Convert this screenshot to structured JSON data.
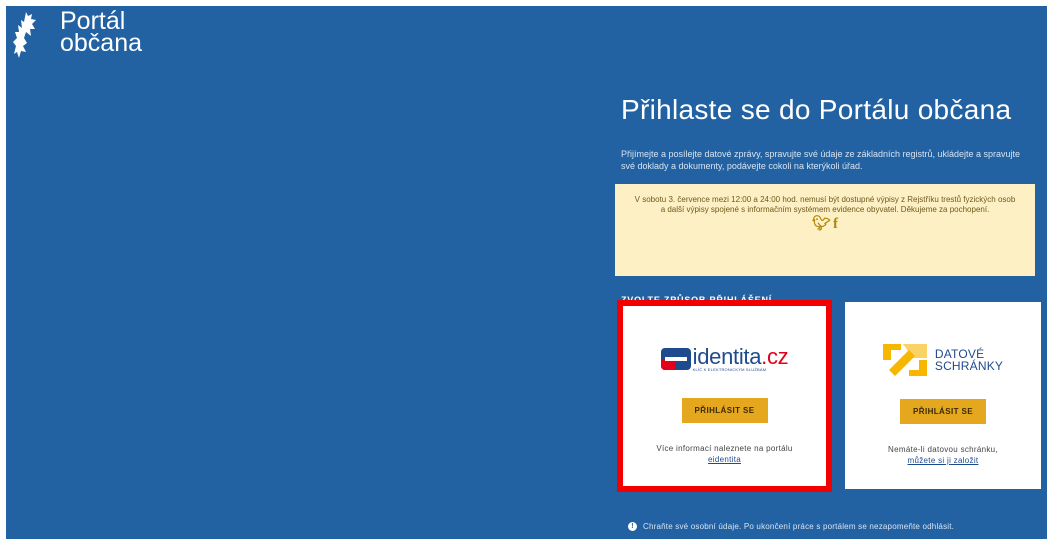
{
  "header": {
    "brand_line1": "Portál",
    "brand_line2": "občana",
    "logo_icon": "czech-lion-emblem-icon"
  },
  "main": {
    "title": "Přihlaste se do Portálu občana",
    "intro": "Přijímejte a posílejte datové zprávy, spravujte své údaje ze základních registrů, ukládejte a spravujte své doklady a dokumenty, podávejte cokoli na kterýkoli úřad.",
    "notice": "V sobotu 3. července mezi 12:00 a 24:00 hod. nemusí být dostupné výpisy z Rejstříku trestů fyzických osob a další výpisy spojené s informačním systémem evidence obyvatel. Děkujeme za pochopení.",
    "social_icons": [
      "twitter-icon",
      "facebook-icon"
    ],
    "choose_label": "ZVOLTE ZPŮSOB PŘIHLÁŠENÍ"
  },
  "cards": {
    "eidentita": {
      "logo_name": "identita",
      "logo_tld": ".cz",
      "logo_sub": "KLÍČ K ELEKTRONICKÝM SLUŽBÁM",
      "button": "PŘIHLÁSIT SE",
      "desc_text": "Více informací naleznete na portálu",
      "desc_link": "eidentita"
    },
    "datove_schranky": {
      "logo_line1": "DATOVÉ",
      "logo_line2": "SCHRÁNKY",
      "button": "PŘIHLÁSIT SE",
      "desc_text": "Nemáte-li datovou schránku,",
      "desc_link": "můžete si ji založit"
    }
  },
  "footer": {
    "note": "Chraňte své osobní údaje. Po ukončení práce s portálem se nezapomeňte odhlásit."
  },
  "colors": {
    "background": "#2362a2",
    "notice_bg": "#fdf0c4",
    "button": "#e4a71d",
    "highlight": "#f20000"
  }
}
